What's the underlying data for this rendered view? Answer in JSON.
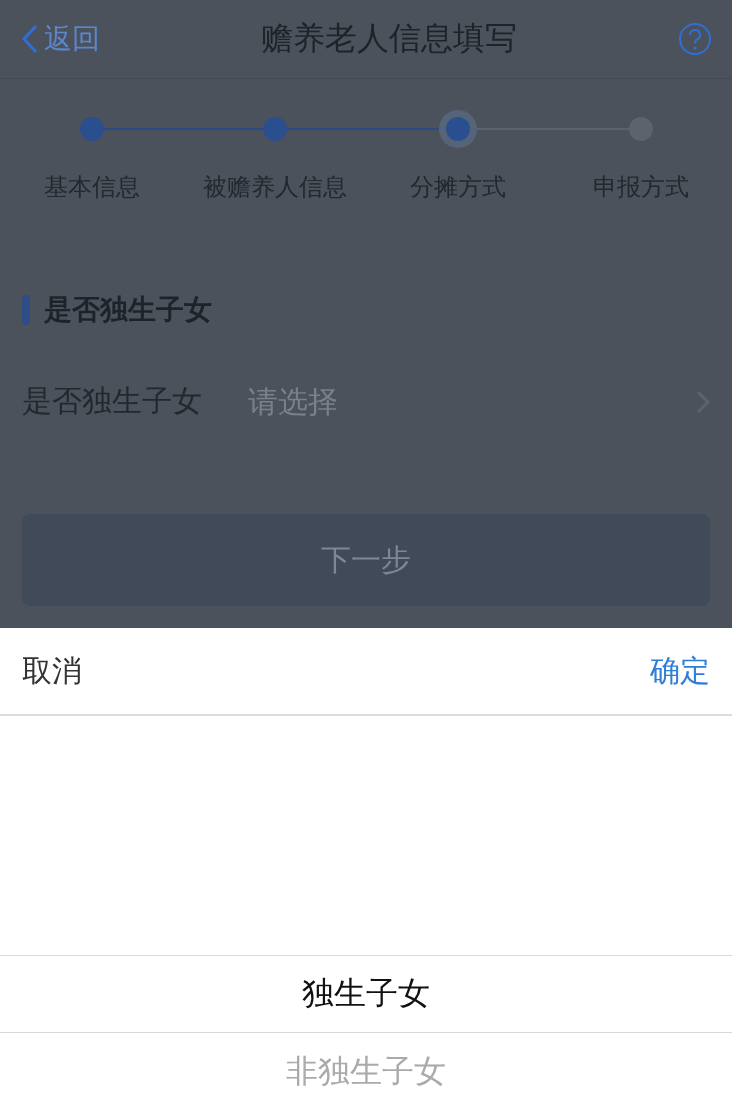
{
  "nav": {
    "back": "返回",
    "title": "赡养老人信息填写"
  },
  "steps": [
    {
      "label": "基本信息",
      "done": true,
      "current": false
    },
    {
      "label": "被赡养人信息",
      "done": true,
      "current": false
    },
    {
      "label": "分摊方式",
      "done": false,
      "current": true
    },
    {
      "label": "申报方式",
      "done": false,
      "current": false
    }
  ],
  "section": {
    "title": "是否独生子女"
  },
  "field": {
    "label": "是否独生子女",
    "placeholder": "请选择"
  },
  "next_button": "下一步",
  "picker": {
    "cancel": "取消",
    "confirm": "确定",
    "options": [
      {
        "label": "独生子女",
        "selected": true
      },
      {
        "label": "非独生子女",
        "selected": false
      }
    ]
  }
}
